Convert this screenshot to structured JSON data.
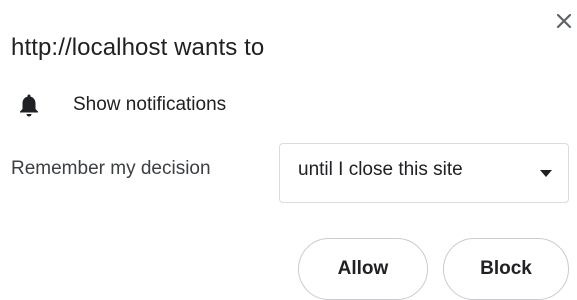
{
  "dialog": {
    "title": "http://localhost wants to",
    "close_icon": "close-icon"
  },
  "permission": {
    "icon": "bell-icon",
    "label": "Show notifications"
  },
  "remember": {
    "label": "Remember my decision",
    "selected": "until I close this site",
    "caret_icon": "caret-down-icon"
  },
  "actions": {
    "allow_label": "Allow",
    "block_label": "Block"
  },
  "colors": {
    "text": "#202124",
    "secondary_text": "#3c4043",
    "border": "#dadce0",
    "background": "#ffffff"
  }
}
